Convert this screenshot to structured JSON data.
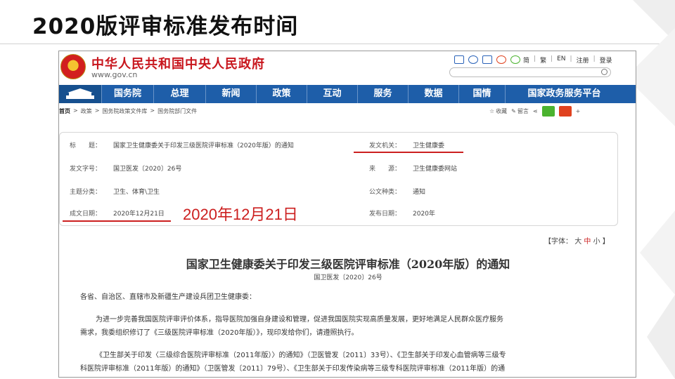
{
  "slide": {
    "title": "2020版评审标准发布时间"
  },
  "site": {
    "name": "中华人民共和国中央人民政府",
    "domain": "www.gov.cn",
    "top_links": [
      "简",
      "繁",
      "EN",
      "注册",
      "登录"
    ]
  },
  "nav": {
    "items": [
      "国务院",
      "总理",
      "新闻",
      "政策",
      "互动",
      "服务",
      "数据",
      "国情",
      "国家政务服务平台"
    ]
  },
  "breadcrumb": [
    "首页",
    "政策",
    "国务院政策文件库",
    "国务院部门文件"
  ],
  "tools": {
    "favorite": "收藏",
    "comment": "留言"
  },
  "meta": {
    "title_label": "标　　题：",
    "title_value": "国家卫生健康委关于印发三级医院评审标准（2020年版）的通知",
    "issuer_label": "发文机关：",
    "issuer_value": "卫生健康委",
    "doc_no_label": "发文字号：",
    "doc_no_value": "国卫医发〔2020〕26号",
    "source_label": "来　　源：",
    "source_value": "卫生健康委网站",
    "topic_label": "主题分类：",
    "topic_value": "卫生、体育\\卫生",
    "type_label": "公文种类：",
    "type_value": "通知",
    "date_label": "成文日期：",
    "date_value": "2020年12月21日",
    "pub_label": "发布日期：",
    "pub_value": "2020年"
  },
  "annotation": "2020年12月21日",
  "font_size": {
    "prefix": "【字体：",
    "large": "大",
    "medium": "中",
    "small": "小",
    "suffix": "】"
  },
  "document": {
    "title": "国家卫生健康委关于印发三级医院评审标准（2020年版）的通知",
    "number": "国卫医发〔2020〕26号",
    "salutation": "各省、自治区、直辖市及新疆生产建设兵团卫生健康委：",
    "para1_line1": "为进一步完善我国医院评审评价体系，指导医院加强自身建设和管理，促进我国医院实现高质量发展，更好地满足人民群众医疗服务",
    "para1_line2": "需求，我委组织修订了《三级医院评审标准（2020年版）》，现印发给你们，请遵照执行。",
    "para2_line1": "《卫生部关于印发〈三级综合医院评审标准（2011年版）〉的通知》（卫医管发〔2011〕33号）、《卫生部关于印发心血管病等三级专",
    "para2_line2": "科医院评审标准（2011年版）的通知》（卫医管发〔2011〕79号）、《卫生部关于印发传染病等三级专科医院评审标准（2011年版）的通"
  },
  "colors": {
    "nav_blue": "#1e5ea9",
    "brand_red": "#c8161d",
    "annotation_red": "#cc1f1f"
  }
}
